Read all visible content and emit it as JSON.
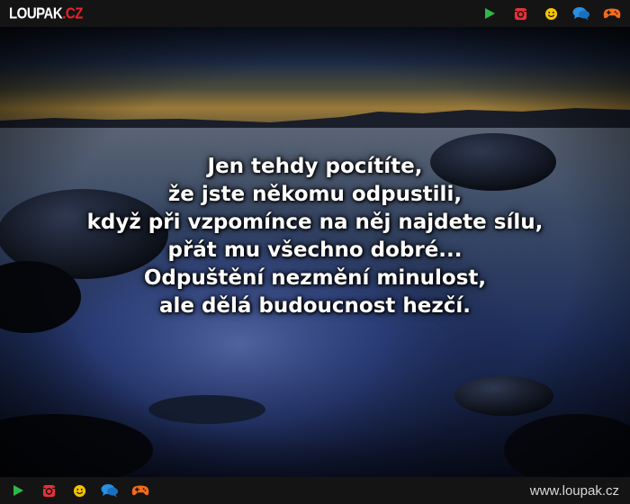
{
  "header": {
    "logo": {
      "word": "LOUPAK",
      "tld": ".CZ"
    },
    "icons": [
      "play-icon",
      "instagram-icon",
      "smiley-icon",
      "chat-icon",
      "gamepad-icon"
    ]
  },
  "quote": {
    "lines": [
      "Jen tehdy pocítíte,",
      "že jste někomu odpustili,",
      "když při vzpomínce na něj najdete sílu,",
      "přát mu všechno dobré...",
      "Odpuštění nezmění minulost,",
      "ale dělá budoucnost hezčí."
    ]
  },
  "footer": {
    "url": "www.loupak.cz",
    "icons": [
      "play-icon",
      "instagram-icon",
      "smiley-icon",
      "chat-icon",
      "gamepad-icon"
    ]
  },
  "colors": {
    "bar_bg": "#141414",
    "logo_accent": "#e8232a",
    "play": "#2fb84a",
    "instagram": "#e53238",
    "smiley": "#f5c400",
    "chat": "#2b8fe0",
    "gamepad": "#f26a1b"
  }
}
